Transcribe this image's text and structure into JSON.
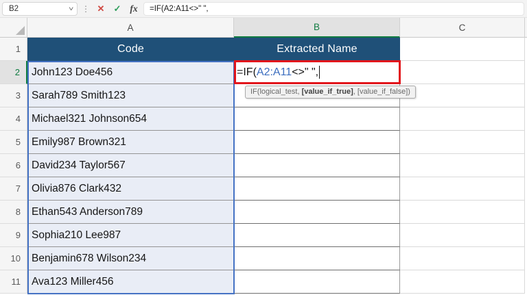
{
  "formula_bar": {
    "name_box_value": "B2",
    "more_icon": "⋮",
    "cancel_icon": "✕",
    "confirm_icon": "✓",
    "fx_icon": "fx",
    "formula": "=IF(A2:A11<>\" \","
  },
  "columns": {
    "a": "A",
    "b": "B",
    "c": "C"
  },
  "header_row": {
    "row_num": "1",
    "code": "Code",
    "extracted": "Extracted Name"
  },
  "b2": {
    "prefix": "=IF(",
    "range": "A2:A11",
    "suffix": "<>\" \","
  },
  "data_rows": [
    {
      "num": "2",
      "code": "John123 Doe456"
    },
    {
      "num": "3",
      "code": "Sarah789 Smith123"
    },
    {
      "num": "4",
      "code": "Michael321 Johnson654"
    },
    {
      "num": "5",
      "code": "Emily987 Brown321"
    },
    {
      "num": "6",
      "code": "David234 Taylor567"
    },
    {
      "num": "7",
      "code": "Olivia876 Clark432"
    },
    {
      "num": "8",
      "code": "Ethan543 Anderson789"
    },
    {
      "num": "9",
      "code": "Sophia210 Lee987"
    },
    {
      "num": "10",
      "code": "Benjamin678 Wilson234"
    },
    {
      "num": "11",
      "code": "Ava123 Miller456"
    }
  ],
  "tooltip": {
    "pre": "IF(logical_test, ",
    "bold": "[value_if_true]",
    "post": ", [value_if_false])"
  },
  "colors": {
    "header_navy": "#1f5078",
    "selected_green": "#107c41",
    "reference_blue": "#3b6dbf",
    "range_border_blue": "#4472c4",
    "editing_cell_red": "#e2161c",
    "row_fill": "#e9edf6"
  }
}
